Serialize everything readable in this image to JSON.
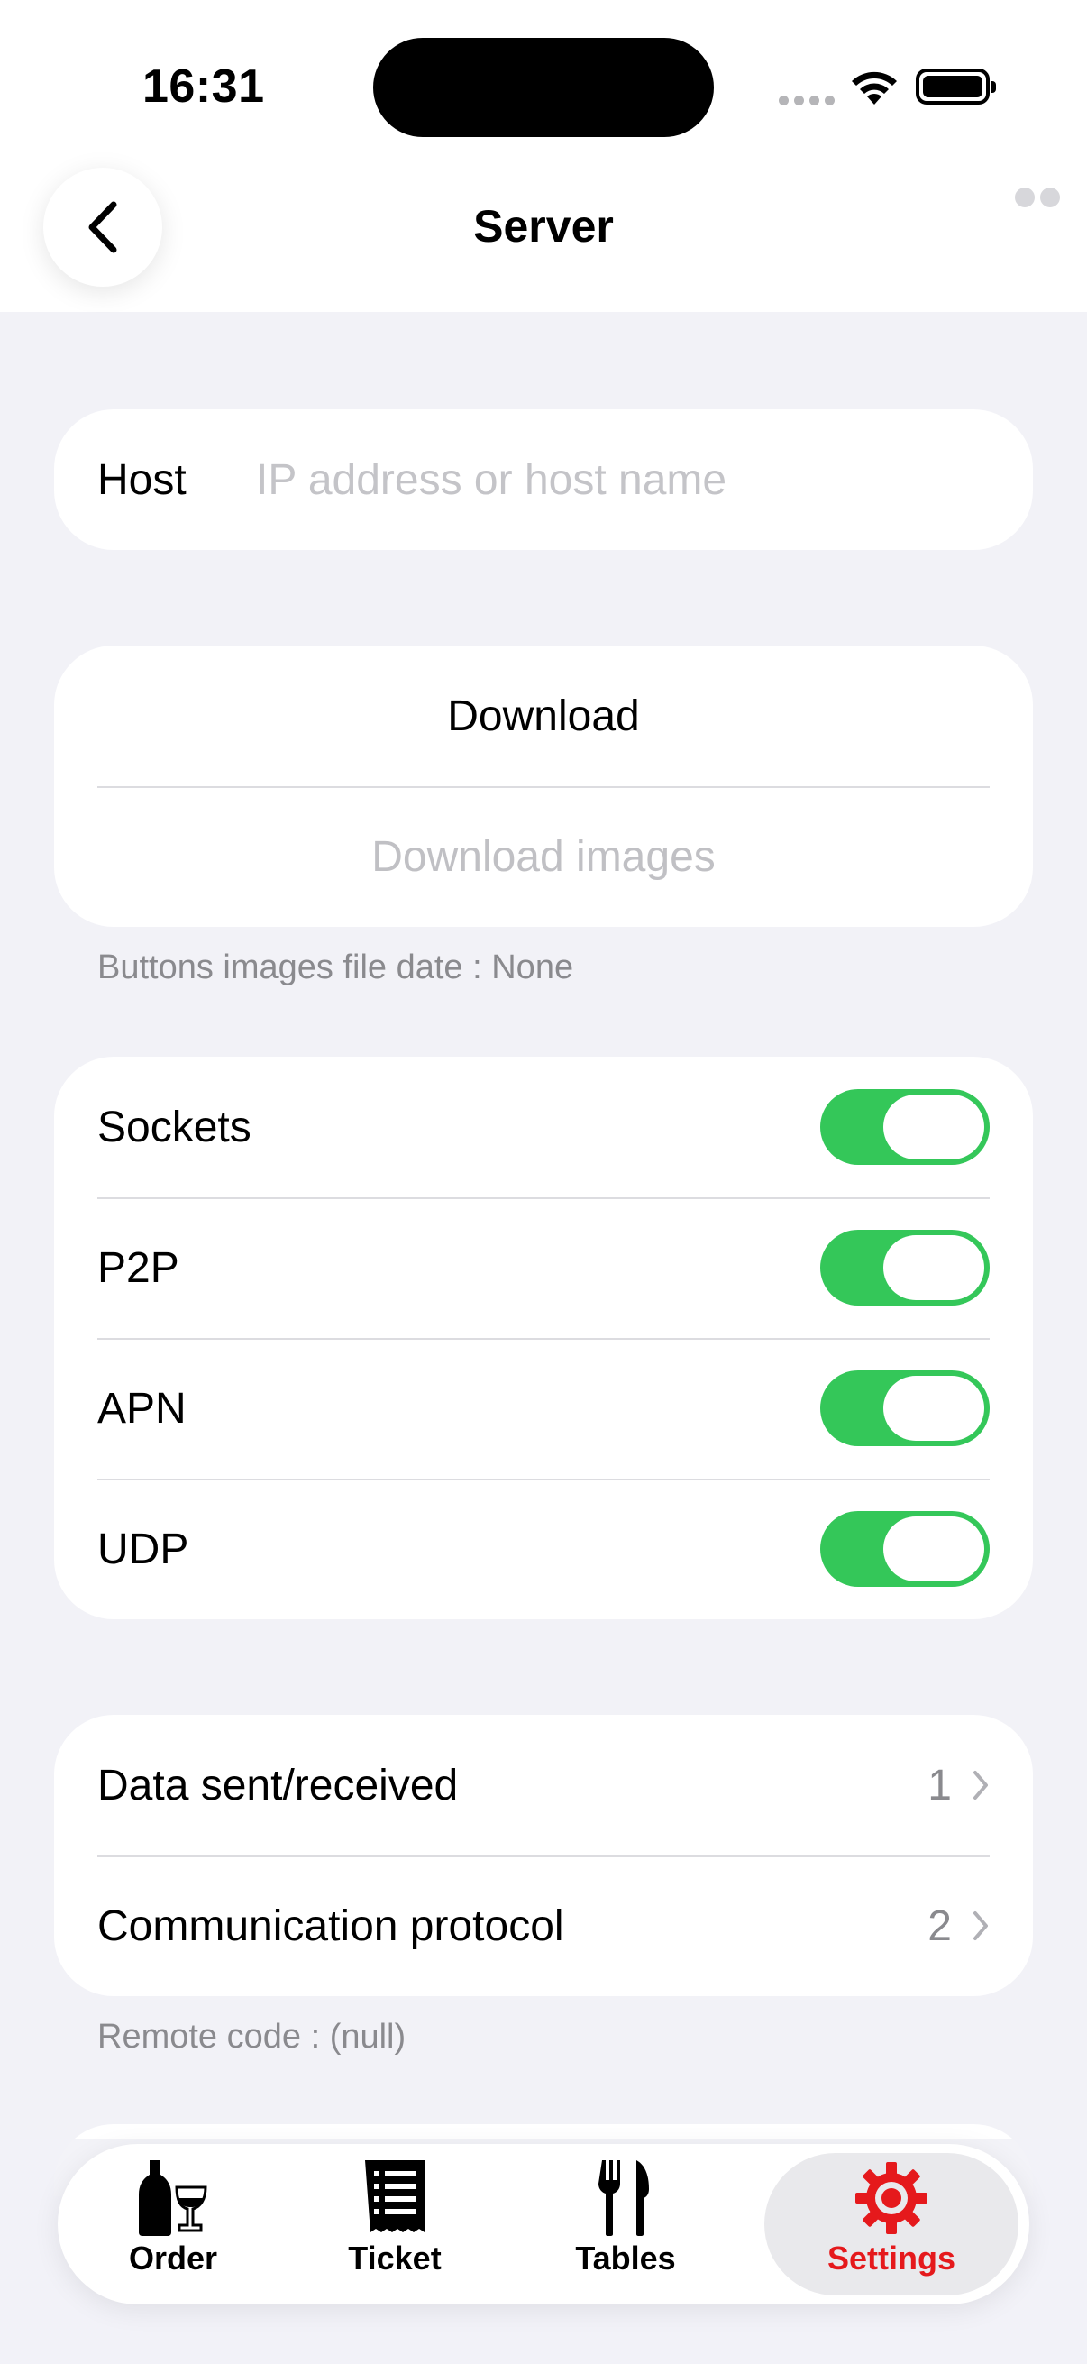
{
  "status_bar": {
    "time": "16:31"
  },
  "nav": {
    "title": "Server"
  },
  "host": {
    "label": "Host",
    "placeholder": "IP address or host name",
    "value": ""
  },
  "download": {
    "download_label": "Download",
    "download_images_label": "Download images",
    "footnote": "Buttons images file date : None"
  },
  "toggles": [
    {
      "label": "Sockets",
      "on": true
    },
    {
      "label": "P2P",
      "on": true
    },
    {
      "label": "APN",
      "on": true
    },
    {
      "label": "UDP",
      "on": true
    }
  ],
  "details": [
    {
      "label": "Data sent/received",
      "value": "1"
    },
    {
      "label": "Communication protocol",
      "value": "2"
    }
  ],
  "remote_code": "Remote code : (null)",
  "tabs": [
    {
      "label": "Order",
      "icon": "bottle-glass-icon",
      "active": false
    },
    {
      "label": "Ticket",
      "icon": "receipt-icon",
      "active": false
    },
    {
      "label": "Tables",
      "icon": "fork-knife-icon",
      "active": false
    },
    {
      "label": "Settings",
      "icon": "gear-icon",
      "active": true
    }
  ],
  "colors": {
    "accent_green": "#34c759",
    "active_tab_red": "#e5191c",
    "background": "#f2f2f7"
  }
}
